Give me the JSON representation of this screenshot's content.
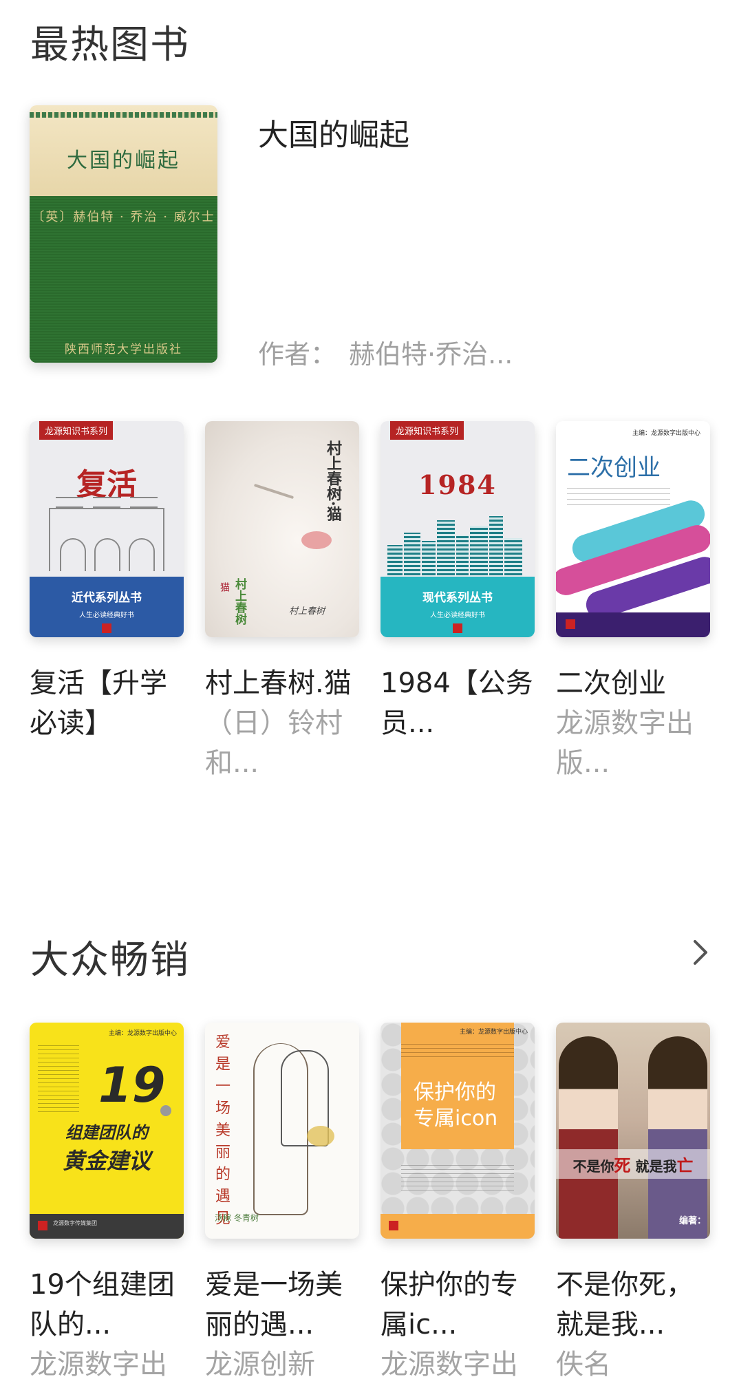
{
  "hot_books": {
    "title": "最热图书",
    "featured": {
      "cover": {
        "title": "大国的崛起",
        "author": "〔英〕赫伯特 · 乔治 · 威尔士",
        "publisher": "陕西师范大学出版社"
      },
      "title": "大国的崛起",
      "author_label": "作者：",
      "author": "赫伯特·乔治..."
    },
    "books": [
      {
        "title": "复活【升学必读】",
        "author": "",
        "cover": {
          "series_tag": "龙源知识书系列",
          "big_title": "复活",
          "band_title": "近代系列丛书",
          "band_sub": "人生必读经典好书"
        }
      },
      {
        "title": "村上春树.猫",
        "author": "（日）铃村和...",
        "cover": {
          "vertical_title": "村上春树·猫",
          "vertical_sub": "村上春树",
          "vertical_sub2": "猫",
          "signature": "村上春树"
        }
      },
      {
        "title": "1984【公务员...",
        "author": "",
        "cover": {
          "series_tag": "龙源知识书系列",
          "big_title": "1984",
          "band_title": "现代系列丛书",
          "band_sub": "人生必读经典好书"
        }
      },
      {
        "title": "二次创业",
        "author": "龙源数字出版...",
        "cover": {
          "top": "主编：龙源数字出版中心",
          "big_title": "二次创业"
        }
      }
    ]
  },
  "bestsellers": {
    "title": "大众畅销",
    "more_icon": "chevron-right-icon",
    "books": [
      {
        "title": "19个组建团队的...",
        "author": "龙源数字出",
        "cover": {
          "top": "主编：龙源数字出版中心",
          "number": "19",
          "line1": "组建团队的",
          "line2": "黄金建议",
          "footer": "龙源数字传媒集团"
        }
      },
      {
        "title": "爱是一场美丽的遇...",
        "author": "龙源创新",
        "cover": {
          "vertical_title": "爱是一场美丽的遇见",
          "signature": "汤稼 冬青树"
        }
      },
      {
        "title": "保护你的专属ic...",
        "author": "龙源数字出",
        "cover": {
          "top": "主编：龙源数字出版中心",
          "line1": "保护你的",
          "line2": "专属icon"
        }
      },
      {
        "title": "不是你死，就是我...",
        "author": "佚名",
        "cover": {
          "text_a": "不是你",
          "text_b": "死",
          "text_c": " 就是我",
          "text_d": "亡",
          "editor": "编著："
        }
      }
    ]
  },
  "colors": {
    "title_text": "#333333",
    "secondary_text": "#a4a4a4",
    "accent_red": "#b62424"
  }
}
